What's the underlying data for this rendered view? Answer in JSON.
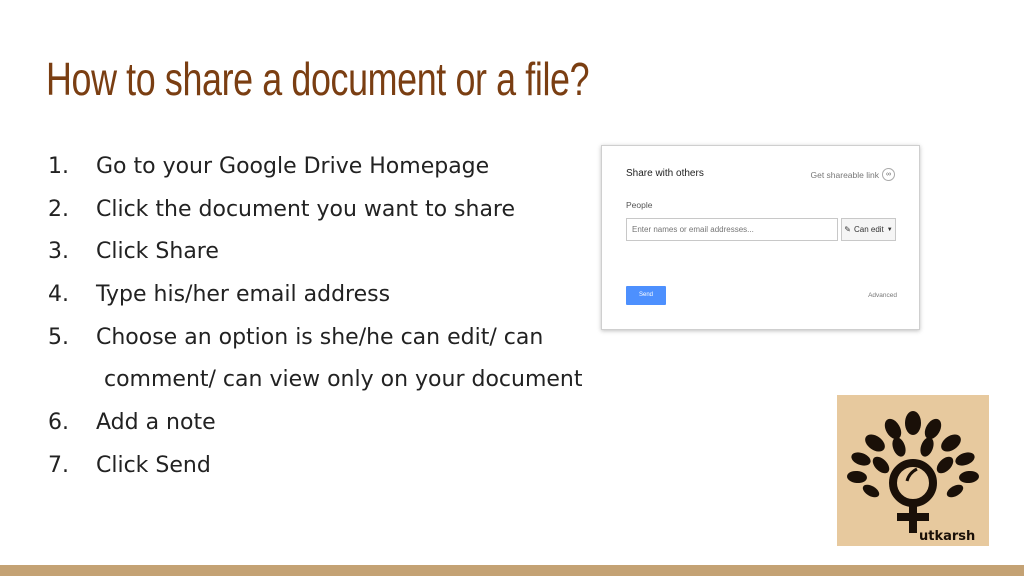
{
  "title": "How to share a document or a file?",
  "steps": [
    {
      "num": "1.",
      "text": "Go to your Google Drive Homepage"
    },
    {
      "num": "2.",
      "text": "Click the document you want to share"
    },
    {
      "num": "3.",
      "text": "Click Share"
    },
    {
      "num": "4.",
      "text": "Type his/her email address"
    },
    {
      "num": "5.",
      "text": "Choose an option is she/he can edit/ can",
      "continuation": "comment/ can view only on your document"
    },
    {
      "num": "6.",
      "text": "Add a note"
    },
    {
      "num": "7.",
      "text": "Click Send"
    }
  ],
  "dialog": {
    "title": "Share with others",
    "link_label": "Get shareable link",
    "people_label": "People",
    "input_placeholder": "Enter names or email addresses...",
    "permission": "Can edit",
    "send_label": "Send",
    "advanced_label": "Advanced"
  },
  "logo": {
    "text": "utkarsh",
    "icon": "tree-female-symbol-logo"
  },
  "colors": {
    "title": "#7a3e12",
    "bar": "#c4a274",
    "logo_bg": "#e7c99e",
    "send": "#4d90fe"
  }
}
